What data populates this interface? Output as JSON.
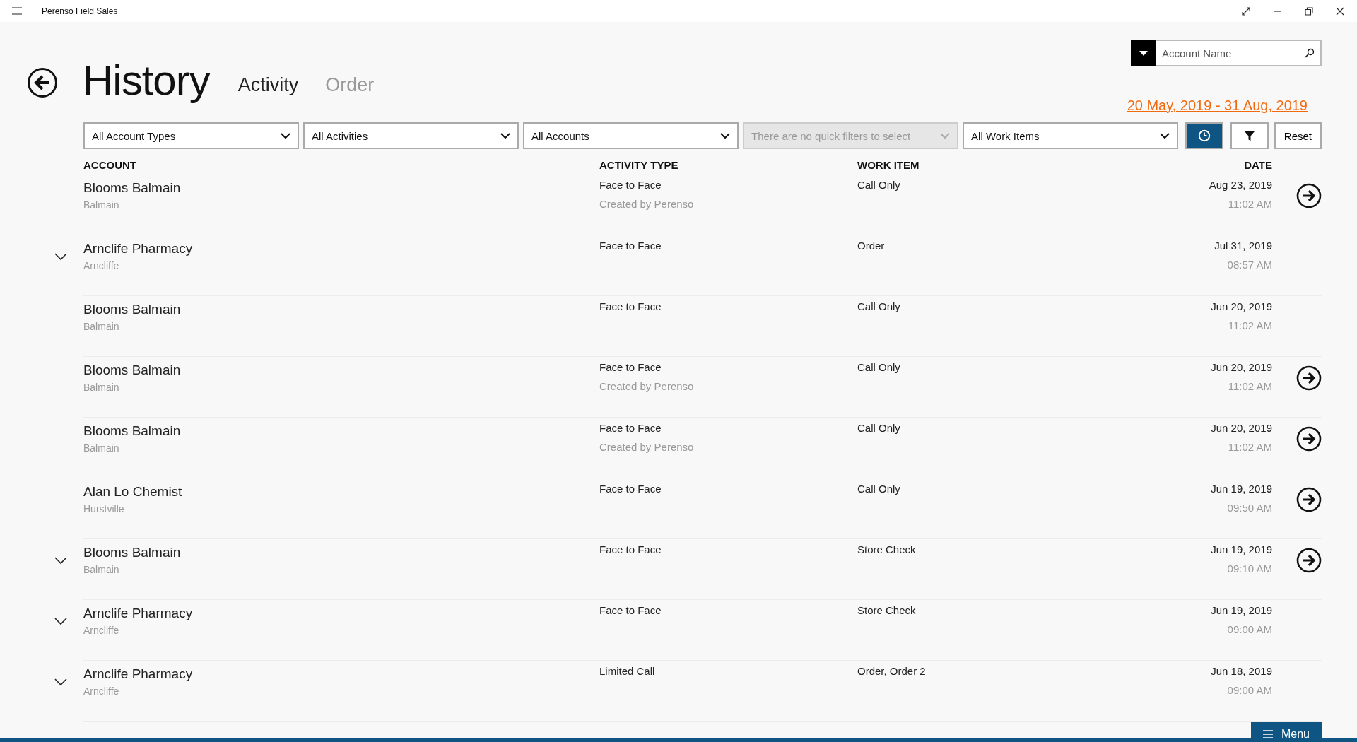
{
  "window": {
    "title": "Perenso Field Sales"
  },
  "page": {
    "title": "History"
  },
  "tabs": [
    {
      "label": "Activity",
      "selected": true
    },
    {
      "label": "Order",
      "selected": false
    }
  ],
  "search": {
    "placeholder": "Account Name"
  },
  "date_range": "20 May, 2019 - 31 Aug, 2019",
  "filters": [
    {
      "value": "All Account Types",
      "disabled": false
    },
    {
      "value": "All Activities",
      "disabled": false
    },
    {
      "value": "All Accounts",
      "disabled": false
    },
    {
      "value": "There are no quick filters to select",
      "disabled": true
    },
    {
      "value": "All Work Items",
      "disabled": false
    }
  ],
  "toolbar": {
    "date_filter_active": true,
    "filter_active": false,
    "reset_label": "Reset"
  },
  "table": {
    "columns": [
      "ACCOUNT",
      "ACTIVITY TYPE",
      "WORK ITEM",
      "DATE"
    ],
    "rows": [
      {
        "account": "Blooms Balmain",
        "suburb": "Balmain",
        "activity": "Face to Face",
        "created_by": "Created by Perenso",
        "work_item": "Call Only",
        "date": "Aug 23, 2019",
        "time": "11:02 AM",
        "expandable": false,
        "has_link": true
      },
      {
        "account": "Arnclife Pharmacy",
        "suburb": "Arncliffe",
        "activity": "Face to Face",
        "work_item": "Order",
        "date": "Jul 31, 2019",
        "time": "08:57 AM",
        "expandable": true,
        "has_link": false
      },
      {
        "account": "Blooms Balmain",
        "suburb": "Balmain",
        "activity": "Face to Face",
        "work_item": "Call Only",
        "date": "Jun 20, 2019",
        "time": "11:02 AM",
        "expandable": false,
        "has_link": false
      },
      {
        "account": "Blooms Balmain",
        "suburb": "Balmain",
        "activity": "Face to Face",
        "created_by": "Created by Perenso",
        "work_item": "Call Only",
        "date": "Jun 20, 2019",
        "time": "11:02 AM",
        "expandable": false,
        "has_link": true
      },
      {
        "account": "Blooms Balmain",
        "suburb": "Balmain",
        "activity": "Face to Face",
        "created_by": "Created by Perenso",
        "work_item": "Call Only",
        "date": "Jun 20, 2019",
        "time": "11:02 AM",
        "expandable": false,
        "has_link": true
      },
      {
        "account": "Alan Lo Chemist",
        "suburb": "Hurstville",
        "activity": "Face to Face",
        "work_item": "Call Only",
        "date": "Jun 19, 2019",
        "time": "09:50 AM",
        "expandable": false,
        "has_link": true
      },
      {
        "account": "Blooms Balmain",
        "suburb": "Balmain",
        "activity": "Face to Face",
        "work_item": "Store Check",
        "date": "Jun 19, 2019",
        "time": "09:10 AM",
        "expandable": true,
        "has_link": true
      },
      {
        "account": "Arnclife Pharmacy",
        "suburb": "Arncliffe",
        "activity": "Face to Face",
        "work_item": "Store Check",
        "date": "Jun 19, 2019",
        "time": "09:00 AM",
        "expandable": true,
        "has_link": false
      },
      {
        "account": "Arnclife Pharmacy",
        "suburb": "Arncliffe",
        "activity": "Limited Call",
        "work_item": "Order, Order 2",
        "date": "Jun 18, 2019",
        "time": "09:00 AM",
        "expandable": true,
        "has_link": false
      }
    ]
  },
  "menu_button": {
    "label": "Menu"
  }
}
